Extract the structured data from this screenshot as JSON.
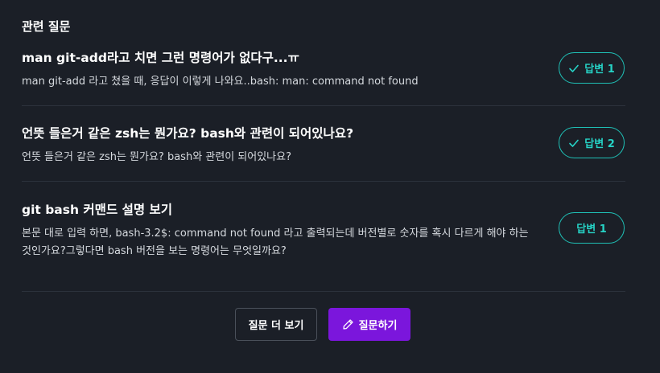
{
  "section": {
    "title": "관련 질문"
  },
  "questions": [
    {
      "title": "man git-add라고 치면 그런 명령어가 없다구...ㅠ",
      "body": "man git-add 라고 쳤을 때, 응답이 이렇게 나와요..bash: man: command not found",
      "answer_label": "답변 1",
      "answered": true
    },
    {
      "title": "언뜻 들은거 같은 zsh는 뭔가요? bash와 관련이 되어있나요?",
      "body": "언뜻 들은거 같은 zsh는 뭔가요? bash와 관련이 되어있나요?",
      "answer_label": "답변 2",
      "answered": true
    },
    {
      "title": "git bash 커맨드 설명 보기",
      "body": "본문 대로 입력 하면, bash-3.2$: command not found 라고 출력되는데 버전별로 숫자를 혹시 다르게 해야 하는 것인가요?그렇다면 bash 버전을 보는 명령어는 무엇일까요?",
      "answer_label": "답변 1",
      "answered": false
    }
  ],
  "footer": {
    "more_label": "질문 더 보기",
    "ask_label": "질문하기"
  },
  "colors": {
    "accent_teal": "#1fc0b6",
    "primary_purple": "#7b16dc",
    "background": "#1b1f27"
  },
  "icons": {
    "answered": "check-icon",
    "ask": "pencil-icon"
  }
}
